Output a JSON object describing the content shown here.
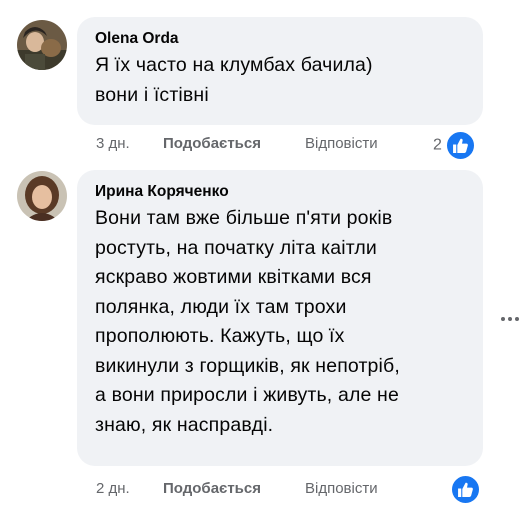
{
  "comments": [
    {
      "author": "Olena Orda",
      "lines": [
        "Я їх часто на клумбах бачила)",
        "вони і їстівні"
      ],
      "time": "3 дн.",
      "like_label": "Подобається",
      "reply_label": "Відповісти",
      "reaction_count": "2"
    },
    {
      "author": "Ирина Коряченко",
      "lines": [
        "Вони там вже більше п'яти років",
        "ростуть, на початку літа каітли",
        "яскраво жовтими квітками вся",
        "полянка, люди їх там трохи",
        "прополюють. Кажуть, що їх",
        "викинули з горщиків, як непотріб,",
        "а вони приросли і живуть, але не",
        "знаю, як насправді."
      ],
      "time": "2 дн.",
      "like_label": "Подобається",
      "reply_label": "Відповісти"
    }
  ],
  "colors": {
    "bubble": "#f0f2f5",
    "meta": "#65676b",
    "like": "#1877f2"
  },
  "icons": {
    "reaction": "thumbs-up-icon",
    "more": "more-options-icon"
  }
}
